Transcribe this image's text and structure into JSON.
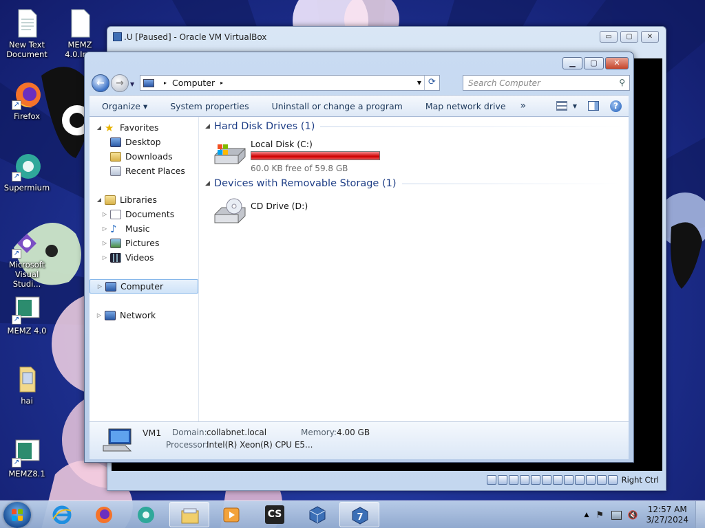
{
  "desktop": {
    "icons": [
      {
        "label": "New Text Document",
        "icon": "text-file-icon"
      },
      {
        "label": "MEMZ 4.0.In...",
        "icon": "file-icon"
      },
      {
        "label": "Firefox",
        "icon": "firefox-icon"
      },
      {
        "label": "Supermium",
        "icon": "supermium-icon"
      },
      {
        "label": "Microsoft Visual Studi...",
        "icon": "visual-studio-icon"
      },
      {
        "label": "MEMZ 4.0",
        "icon": "program-icon"
      },
      {
        "label": "hai",
        "icon": "folder-icon"
      },
      {
        "label": "MEMZ8.1",
        "icon": "program-icon"
      }
    ]
  },
  "virtualbox": {
    "title": ".U [Paused] - Oracle VM VirtualBox",
    "controls": {
      "minimize": "▭",
      "maximize": "▢",
      "close": "✕"
    },
    "hostkey": "Right Ctrl"
  },
  "explorer": {
    "address": {
      "root_arrow": "▸",
      "location": "Computer",
      "after_arrow": "▸"
    },
    "search_placeholder": "Search Computer",
    "commands": {
      "organize": "Organize ▾",
      "system_properties": "System properties",
      "uninstall": "Uninstall or change a program",
      "map_drive": "Map network drive",
      "more": "»"
    },
    "nav": {
      "favorites": "Favorites",
      "desktop": "Desktop",
      "downloads": "Downloads",
      "recent_places": "Recent Places",
      "libraries": "Libraries",
      "documents": "Documents",
      "music": "Music",
      "pictures": "Pictures",
      "videos": "Videos",
      "computer": "Computer",
      "network": "Network"
    },
    "groups": {
      "hdd": "Hard Disk Drives (1)",
      "removable": "Devices with Removable Storage (1)"
    },
    "drives": {
      "c_name": "Local Disk (C:)",
      "c_free": "60.0 KB free of 59.8 GB",
      "c_used_fraction": 0.999,
      "d_name": "CD Drive (D:)"
    },
    "details": {
      "name": "VM1",
      "domain_label": "Domain:",
      "domain": "collabnet.local",
      "memory_label": "Memory:",
      "memory": "4.00 GB",
      "processor_label": "Processor:",
      "processor": "Intel(R) Xeon(R) CPU E5..."
    }
  },
  "taskbar": {
    "apps": [
      "internet-explorer-icon",
      "firefox-icon",
      "supermium-icon",
      "file-explorer-icon",
      "media-player-icon",
      "cs-app-icon",
      "virtualbox-icon",
      "windows7-app-icon"
    ],
    "cs_label": "CS",
    "time": "12:57 AM",
    "date": "3/27/2024"
  },
  "colors": {
    "accent": "#1e3e86",
    "drive_full": "#d81e1e"
  }
}
